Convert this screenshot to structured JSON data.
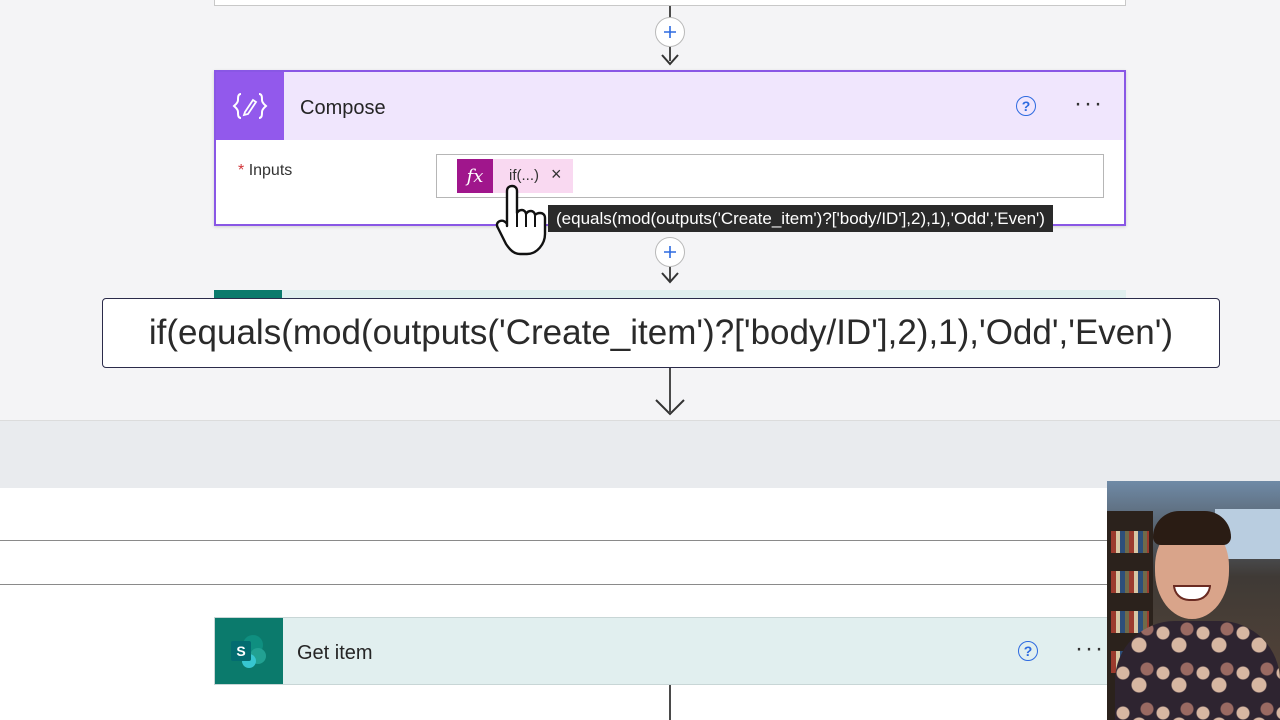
{
  "compose": {
    "title": "Compose",
    "inputs_required_mark": "*",
    "inputs_label": "Inputs",
    "token_icon": "fx",
    "token_label": "if(...)",
    "token_remove": "×",
    "help_icon": "?",
    "more_icon": "···"
  },
  "tooltip": {
    "text": "(equals(mod(outputs('Create_item')?['body/ID'],2),1),'Odd','Even')"
  },
  "formula_callout": {
    "text": "if(equals(mod(outputs('Create_item')?['body/ID'],2),1),'Odd','Even')"
  },
  "get_item": {
    "title": "Get item",
    "help_icon": "?",
    "more_icon": "···"
  },
  "colors": {
    "compose_accent": "#9259ec",
    "compose_header": "#f0e6fd",
    "sharepoint_accent": "#0b7a6c",
    "expression_token": "#a0168c",
    "help_blue": "#2d6ae0"
  },
  "icons": [
    "add-step-icon",
    "compose-icon",
    "fx-icon",
    "help-icon",
    "more-options-icon",
    "hand-cursor-icon",
    "sharepoint-icon",
    "arrow-down-icon"
  ]
}
